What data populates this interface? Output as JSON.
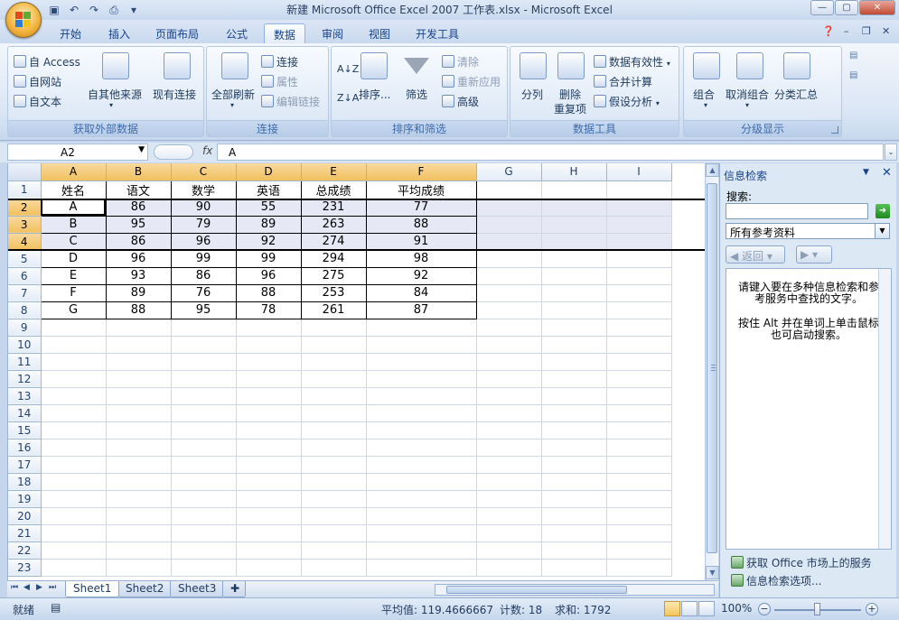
{
  "window": {
    "title": "新建 Microsoft Office Excel 2007 工作表.xlsx - Microsoft Excel"
  },
  "tabs": [
    "开始",
    "插入",
    "页面布局",
    "公式",
    "数据",
    "审阅",
    "视图",
    "开发工具"
  ],
  "active_tab": "数据",
  "ribbon": {
    "get_external": {
      "name": "获取外部数据",
      "access": "自 Access",
      "web": "自网站",
      "text": "自文本",
      "other": "自其他来源",
      "existing": "现有连接"
    },
    "connections": {
      "name": "连接",
      "refresh_all": "全部刷新",
      "connections": "连接",
      "properties": "属性",
      "edit_links": "编辑链接"
    },
    "sort_filter": {
      "name": "排序和筛选",
      "sort": "排序...",
      "filter": "筛选",
      "clear": "清除",
      "reapply": "重新应用",
      "advanced": "高级"
    },
    "data_tools": {
      "name": "数据工具",
      "text_to_columns": "分列",
      "remove_dup_1": "删除",
      "remove_dup_2": "重复项",
      "validation": "数据有效性",
      "consolidate": "合并计算",
      "what_if": "假设分析"
    },
    "outline": {
      "name": "分级显示",
      "group": "组合",
      "ungroup": "取消组合",
      "subtotal": "分类汇总"
    }
  },
  "formula_bar": {
    "name_box": "A2",
    "fx": "fx",
    "value": "A"
  },
  "sheet": {
    "columns": [
      "A",
      "B",
      "C",
      "D",
      "E",
      "F",
      "G",
      "H",
      "I"
    ],
    "row_numbers": [
      "1",
      "2",
      "3",
      "4",
      "5",
      "6",
      "7",
      "8",
      "9",
      "10",
      "11",
      "12",
      "13",
      "14",
      "15",
      "16",
      "17",
      "18",
      "19",
      "20",
      "21",
      "22",
      "23"
    ],
    "rows": [
      [
        "姓名",
        "语文",
        "数学",
        "英语",
        "总成绩",
        "平均成绩"
      ],
      [
        "A",
        "86",
        "90",
        "55",
        "231",
        "77"
      ],
      [
        "B",
        "95",
        "79",
        "89",
        "263",
        "88"
      ],
      [
        "C",
        "86",
        "96",
        "92",
        "274",
        "91"
      ],
      [
        "D",
        "96",
        "99",
        "99",
        "294",
        "98"
      ],
      [
        "E",
        "93",
        "86",
        "96",
        "275",
        "92"
      ],
      [
        "F",
        "89",
        "76",
        "88",
        "253",
        "84"
      ],
      [
        "G",
        "88",
        "95",
        "78",
        "261",
        "87"
      ]
    ],
    "tabs": [
      "Sheet1",
      "Sheet2",
      "Sheet3"
    ],
    "active_sheet": "Sheet1"
  },
  "research_pane": {
    "title": "信息检索",
    "search_label": "搜索:",
    "search_value": "",
    "source": "所有参考资料",
    "back": "返回",
    "hint_1": "请键入要在多种信息检索和参考服务中查找的文字。",
    "hint_2": "按住 Alt 并在单词上单击鼠标也可启动搜索。",
    "link_services": "获取 Office 市场上的服务",
    "link_options": "信息检索选项..."
  },
  "status_bar": {
    "mode": "就绪",
    "average": "平均值: 119.4666667",
    "count": "计数: 18",
    "sum": "求和: 1792",
    "zoom": "100%"
  }
}
